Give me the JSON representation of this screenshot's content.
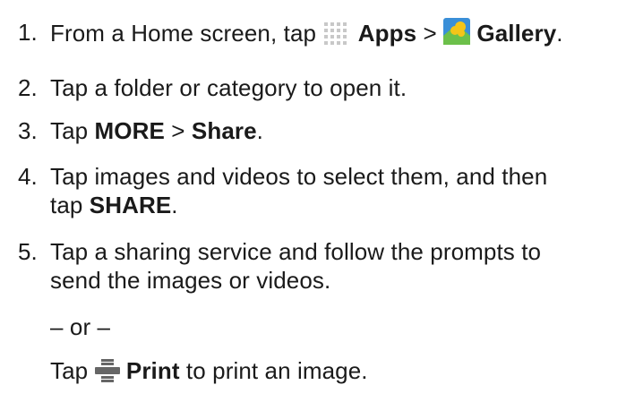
{
  "steps": [
    {
      "number": "1.",
      "parts": {
        "a": "From a Home screen, tap ",
        "apps": "Apps",
        "sep": " > ",
        "gallery": "Gallery",
        "end": "."
      },
      "icons": [
        "apps-grid-icon",
        "gallery-icon"
      ]
    },
    {
      "number": "2.",
      "text": "Tap a folder or category to open it."
    },
    {
      "number": "3.",
      "parts": {
        "a": "Tap ",
        "more": "MORE",
        "sep": " > ",
        "share": "Share",
        "end": "."
      }
    },
    {
      "number": "4.",
      "line1": "Tap images and videos to select them, and then",
      "parts": {
        "a": "tap ",
        "share": "SHARE",
        "end": "."
      }
    },
    {
      "number": "5.",
      "line1": "Tap a sharing service and follow the prompts to",
      "line2": "send the images or videos."
    }
  ],
  "alternative": {
    "or": "– or –",
    "parts": {
      "a": "Tap ",
      "print": "Print",
      "end": " to print an image."
    },
    "icon": "printer-icon"
  },
  "colors": {
    "text": "#1a1a1a",
    "apps_icon": "#c8c8c8",
    "gallery_blue": "#3a8fd8",
    "gallery_yellow": "#f5c518",
    "printer": "#666666"
  }
}
